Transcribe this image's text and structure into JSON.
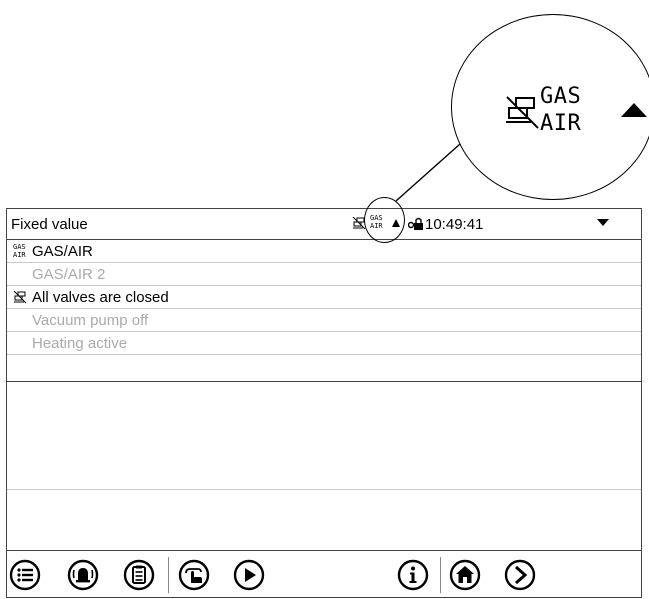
{
  "header": {
    "title": "Fixed value",
    "gas_line1": "GAS",
    "gas_line2": "AIR",
    "time": "10:49:41"
  },
  "callout": {
    "gas_line1": "GAS",
    "gas_line2": "AIR"
  },
  "list": {
    "items": [
      {
        "label": "GAS/AIR",
        "icon": "gas-air-icon",
        "active": true
      },
      {
        "label": "GAS/AIR 2",
        "icon": "",
        "active": false
      },
      {
        "label": "All valves are closed",
        "icon": "valves-closed-icon",
        "active": true
      },
      {
        "label": "Vacuum pump off",
        "icon": "",
        "active": false
      },
      {
        "label": "Heating active",
        "icon": "",
        "active": false
      }
    ]
  },
  "toolbar": {
    "buttons": [
      "menu-icon",
      "alarm-icon",
      "clipboard-icon",
      "hand-icon",
      "play-icon",
      "info-icon",
      "home-icon",
      "next-icon"
    ]
  }
}
